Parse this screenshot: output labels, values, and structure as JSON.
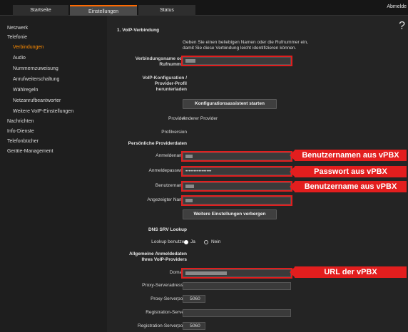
{
  "tabs": [
    {
      "label": "Startseite"
    },
    {
      "label": "Einstellungen"
    },
    {
      "label": "Status"
    }
  ],
  "logout_label": "Abmelde",
  "sidebar": {
    "items": [
      {
        "label": "Netzwerk"
      },
      {
        "label": "Telefonie"
      },
      {
        "label": "Verbindungen"
      },
      {
        "label": "Audio"
      },
      {
        "label": "Nummernzuweisung"
      },
      {
        "label": "Anrufweiterschaltung"
      },
      {
        "label": "Wählregeln"
      },
      {
        "label": "Netzanrufbeantworter"
      },
      {
        "label": "Weitere VoIP-Einstellungen"
      },
      {
        "label": "Nachrichten"
      },
      {
        "label": "Info-Dienste"
      },
      {
        "label": "Telefonbücher"
      },
      {
        "label": "Geräte-Management"
      }
    ]
  },
  "main": {
    "help_icon": "?",
    "section_voip": "1. VoIP-Verbindung",
    "intro_line1": "Geben Sie einen beliebigen Namen oder die Rufnummer ein,",
    "intro_line2": "damit Sie diese Verbindung leicht identifizieren können.",
    "connection_name_label_1": "Verbindungsname oder",
    "connection_name_label_2": "Rufnummer:",
    "voip_config_label_1": "VoIP-Konfiguration /",
    "voip_config_label_2": "Provider-Profil",
    "voip_config_label_3": "herunterladen",
    "config_wizard_button": "Konfigurationsassistent starten",
    "provider_label": "Provider:",
    "provider_value": "Anderer Provider",
    "profile_version_label": "Profilversion",
    "personal_data_section": "Persönliche Providerdaten",
    "login_name_label": "Anmeldename:",
    "login_password_label": "Anmeldepasswort:",
    "password_value": "••••••••••••••••",
    "username_label": "Benutzername:",
    "display_name_label": "Angezeigter Name:",
    "more_settings_button": "Weitere Einstellungen verbergen",
    "dns_srv_section": "DNS SRV Lookup",
    "lookup_label": "Lookup benutzen",
    "radio_yes": "Ja",
    "radio_no": "Nein",
    "general_login_1": "Allgemeine Anmeldedaten",
    "general_login_2": "Ihres VoIP-Providers",
    "domain_label": "Domain:",
    "proxy_address_label": "Proxy-Serveradresse:",
    "proxy_port_label": "Proxy-Serverport:",
    "proxy_port_value": "5060",
    "registration_server_label": "Registration-Server:",
    "registration_port_label": "Registration-Serverport:",
    "registration_port_value": "5060"
  },
  "annotations": {
    "username": "Benutzernamen aus vPBX",
    "password": "Passwort aus vPBX",
    "benutzername": "Benutzername aus vPBX",
    "url": "URL der vPBX"
  },
  "colors": {
    "accent": "#ff8c00",
    "annotation": "#e31e1e",
    "background": "#242424"
  }
}
